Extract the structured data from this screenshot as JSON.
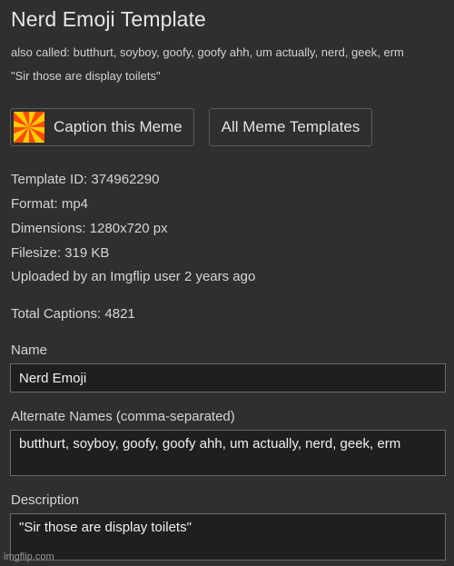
{
  "page": {
    "title": "Nerd Emoji Template",
    "also_called": "also called: butthurt, soyboy, goofy, goofy ahh, um actually, nerd, geek, erm",
    "quote": "\"Sir those are display toilets\""
  },
  "buttons": {
    "caption_label": "Caption this Meme",
    "all_templates_label": "All Meme Templates"
  },
  "info": {
    "template_id": "Template ID: 374962290",
    "format": "Format: mp4",
    "dimensions": "Dimensions: 1280x720 px",
    "filesize": "Filesize: 319 KB",
    "uploaded": "Uploaded by an Imgflip user 2 years ago",
    "total_captions": "Total Captions: 4821"
  },
  "form": {
    "name_label": "Name",
    "name_value": "Nerd Emoji",
    "alt_label": "Alternate Names (comma-separated)",
    "alt_value": "butthurt, soyboy, goofy, goofy ahh, um actually, nerd, geek, erm",
    "description_label": "Description",
    "description_value": "\"Sir those are display toilets\""
  },
  "watermark": "imgflip.com",
  "icons": {
    "caption_button_icon": "imgflip-logo-icon"
  },
  "colors": {
    "background": "#2f2f2f",
    "field_background": "#1f1f1f",
    "logo_yellow": "#ffcc00",
    "logo_orange": "#ff4d00"
  }
}
